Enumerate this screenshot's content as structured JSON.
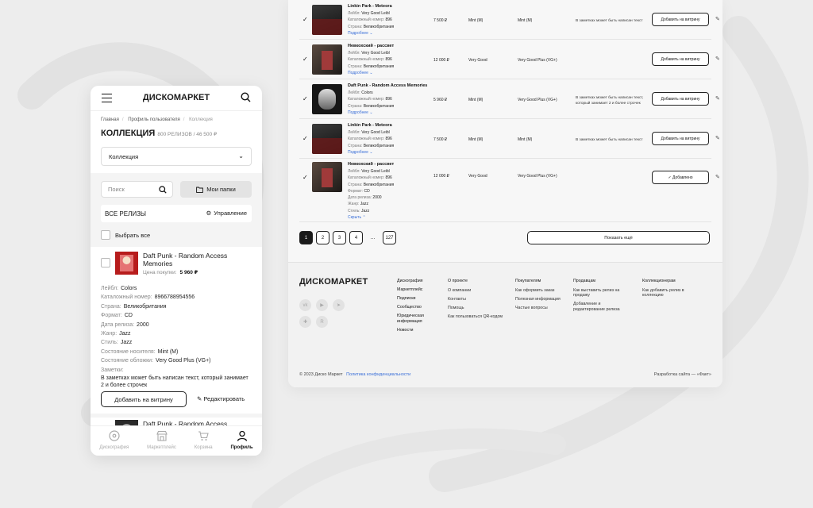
{
  "desktop": {
    "rows": [
      {
        "title": "Linkin Park - Meteora",
        "label_k": "Лейбл:",
        "label": "Very Good Leibl",
        "cat_k": "Каталожный номер:",
        "cat": "896",
        "country_k": "Страна:",
        "country": "Великобритания",
        "more": "Подробнее",
        "price": "7 500 ₽",
        "media": "Mint (M)",
        "sleeve": "Mint (M)",
        "note": "В заметках может быть написан текст",
        "btn": "Добавить на витрину"
      },
      {
        "title": "Невкохский - рассвет",
        "label_k": "Лейбл:",
        "label": "Very Good Leibl",
        "cat_k": "Каталожный номер:",
        "cat": "896",
        "country_k": "Страна:",
        "country": "Великобритания",
        "more": "Подробнее",
        "price": "12 000 ₽",
        "media": "Very Good",
        "sleeve": "Very Good Plus (VG+)",
        "note": "",
        "btn": "Добавить на витрину"
      },
      {
        "title": "Daft Punk - Random Access Memories",
        "label_k": "Лейбл:",
        "label": "Colors",
        "cat_k": "Каталожный номер:",
        "cat": "896",
        "country_k": "Страна:",
        "country": "Великобритания",
        "more": "Подробнее",
        "price": "5 960 ₽",
        "media": "Mint (M)",
        "sleeve": "Very Good Plus (VG+)",
        "note": "В заметках может быть написан текст, который занимает 2 и более строчек",
        "btn": "Добавить на витрину"
      },
      {
        "title": "Linkin Park - Meteora",
        "label_k": "Лейбл:",
        "label": "Very Good Leibl",
        "cat_k": "Каталожный номер:",
        "cat": "896",
        "country_k": "Страна:",
        "country": "Великобритания",
        "more": "Подробнее",
        "price": "7 500 ₽",
        "media": "Mint (M)",
        "sleeve": "Mint (M)",
        "note": "В заметках может быть написан текст",
        "btn": "Добавить на витрину"
      }
    ],
    "expanded_row": {
      "title": "Невкохский - рассвет",
      "label_k": "Лейбл:",
      "label": "Very Good Leibl",
      "cat_k": "Каталожный номер:",
      "cat": "896",
      "country_k": "Страна:",
      "country": "Великобритания",
      "format_k": "Формат:",
      "format": "CD",
      "date_k": "Дата релиза:",
      "date": "2000",
      "genre_k": "Жанр:",
      "genre": "Jazz",
      "style_k": "Стиль:",
      "style": "Jazz",
      "less": "Скрыть",
      "price": "12 000 ₽",
      "media": "Very Good",
      "sleeve": "Very Good Plus (VG+)",
      "btn": "Добавлено"
    },
    "pager": {
      "pages": [
        "1",
        "2",
        "3",
        "4"
      ],
      "dots": "...",
      "last": "127",
      "show_more": "Показать ещё"
    },
    "footer": {
      "logo": "ДИСКОМАРКЕТ",
      "col1": [
        "Дискография",
        "Маркетплейс",
        "Подписки",
        "Сообщество",
        "Юридическая информация",
        "Новости"
      ],
      "col2": {
        "h": "О проекте",
        "items": [
          "О компании",
          "Контакты",
          "Помощь",
          "Как пользоваться QR-кодом"
        ]
      },
      "col3": {
        "h": "Покупателям",
        "items": [
          "Как оформить заказ",
          "Полезная информация",
          "Частые вопросы"
        ]
      },
      "col4": {
        "h": "Продавцам",
        "items": [
          "Как выставить релиз на продажу",
          "Добавление и редактирование релиза"
        ]
      },
      "col5": {
        "h": "Коллекционерам",
        "items": [
          "Как добавить релиз в коллекцию"
        ]
      },
      "copyright": "© 2023 Диско Маркет",
      "privacy": "Политика конфиденциальности",
      "dev": "Разработка сайта — «Факт»"
    }
  },
  "mobile": {
    "logo": "ДИСКОМАРКЕТ",
    "crumbs": [
      "Главная",
      "Профиль пользователя",
      "Коллекция"
    ],
    "title": "КОЛЛЕКЦИЯ",
    "subtitle": "800 РЕЛИЗОВ / 46 500 ₽",
    "select": "Коллекция",
    "search_placeholder": "Поиск",
    "folders": "Мои папки",
    "all": "ВСЕ РЕЛИЗЫ",
    "manage": "Управление",
    "select_all": "Выбрать все",
    "card": {
      "title": "Daft Punk - Random Access Memories",
      "price_k": "Цена покупки:",
      "price": "5 960 ₽",
      "details": [
        {
          "k": "Лейбл:",
          "v": "Colors"
        },
        {
          "k": "Каталожный номер:",
          "v": "8966788954556"
        },
        {
          "k": "Страна:",
          "v": "Великобритания"
        },
        {
          "k": "Формат:",
          "v": "CD"
        },
        {
          "k": "Дата релиза:",
          "v": "2000"
        },
        {
          "k": "Жанр:",
          "v": "Jazz"
        },
        {
          "k": "Стиль:",
          "v": "Jazz"
        },
        {
          "k": "Состояние носителя:",
          "v": "Mint (M)"
        },
        {
          "k": "Состояние обложки:",
          "v": "Very Good Plus (VG+)"
        }
      ],
      "notes_k": "Заметки:",
      "notes": "В заметках может быть написан текст, который занимает 2 и более строчек",
      "add_btn": "Добавить на витрину",
      "edit": "Редактировать"
    },
    "card2_title": "Daft Punk - Random Access",
    "tabs": [
      {
        "label": "Дискография",
        "icon": "disc-icon"
      },
      {
        "label": "Маркетплейс",
        "icon": "store-icon"
      },
      {
        "label": "Корзина",
        "icon": "cart-icon"
      },
      {
        "label": "Профиль",
        "icon": "user-icon"
      }
    ]
  }
}
